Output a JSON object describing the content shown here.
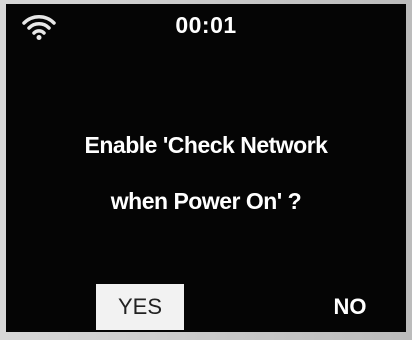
{
  "status_bar": {
    "wifi_icon": "wifi-icon",
    "time": "00:01"
  },
  "dialog": {
    "line1": "Enable 'Check Network",
    "line2": "when Power On' ?"
  },
  "buttons": {
    "yes_label": "YES",
    "no_label": "NO"
  },
  "colors": {
    "screen_bg": "#050505",
    "text": "#ffffff",
    "selected_bg": "#f2f2f2"
  }
}
